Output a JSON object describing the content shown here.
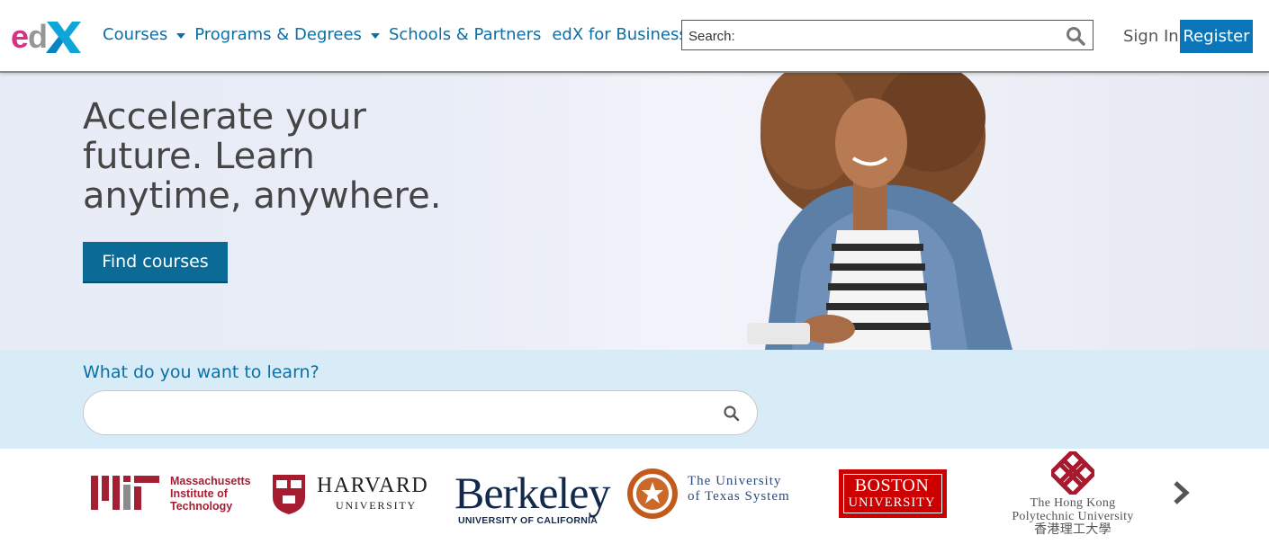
{
  "header": {
    "logo_text": "edX",
    "nav": [
      {
        "label": "Courses",
        "has_caret": true
      },
      {
        "label": "Programs & Degrees",
        "has_caret": true
      },
      {
        "label": "Schools & Partners",
        "has_caret": false
      },
      {
        "label": "edX for Business",
        "has_caret": false
      }
    ],
    "search_placeholder": "Search:",
    "sign_in": "Sign In",
    "register": "Register"
  },
  "hero": {
    "title": "Accelerate your future. Learn anytime, anywhere.",
    "cta": "Find courses"
  },
  "learn": {
    "label": "What do you want to learn?",
    "placeholder": ""
  },
  "partners": {
    "mit": {
      "name": "Massachusetts\nInstitute of\nTechnology"
    },
    "harvard": {
      "name": "HARVARD",
      "sub": "UNIVERSITY",
      "shield_text": "VE RI TAS"
    },
    "berkeley": {
      "name": "Berkeley",
      "sub": "UNIVERSITY OF CALIFORNIA"
    },
    "utexas": {
      "name": "The University\nof Texas System"
    },
    "bu": {
      "name": "BOSTON",
      "sub": "UNIVERSITY"
    },
    "polyu": {
      "name": "The Hong Kong\nPolytechnic University\n香港理工大學"
    }
  },
  "colors": {
    "brand_blue": "#0a6fa8",
    "register_bg": "#0a75b9",
    "cta_bg": "#0b6b96",
    "learn_band": "#d7ecf6",
    "mit_red": "#a31f34",
    "harvard_crimson": "#a51c30",
    "berkeley_navy": "#13294b",
    "bu_red": "#cc0000",
    "polyu_red": "#a6192e"
  }
}
